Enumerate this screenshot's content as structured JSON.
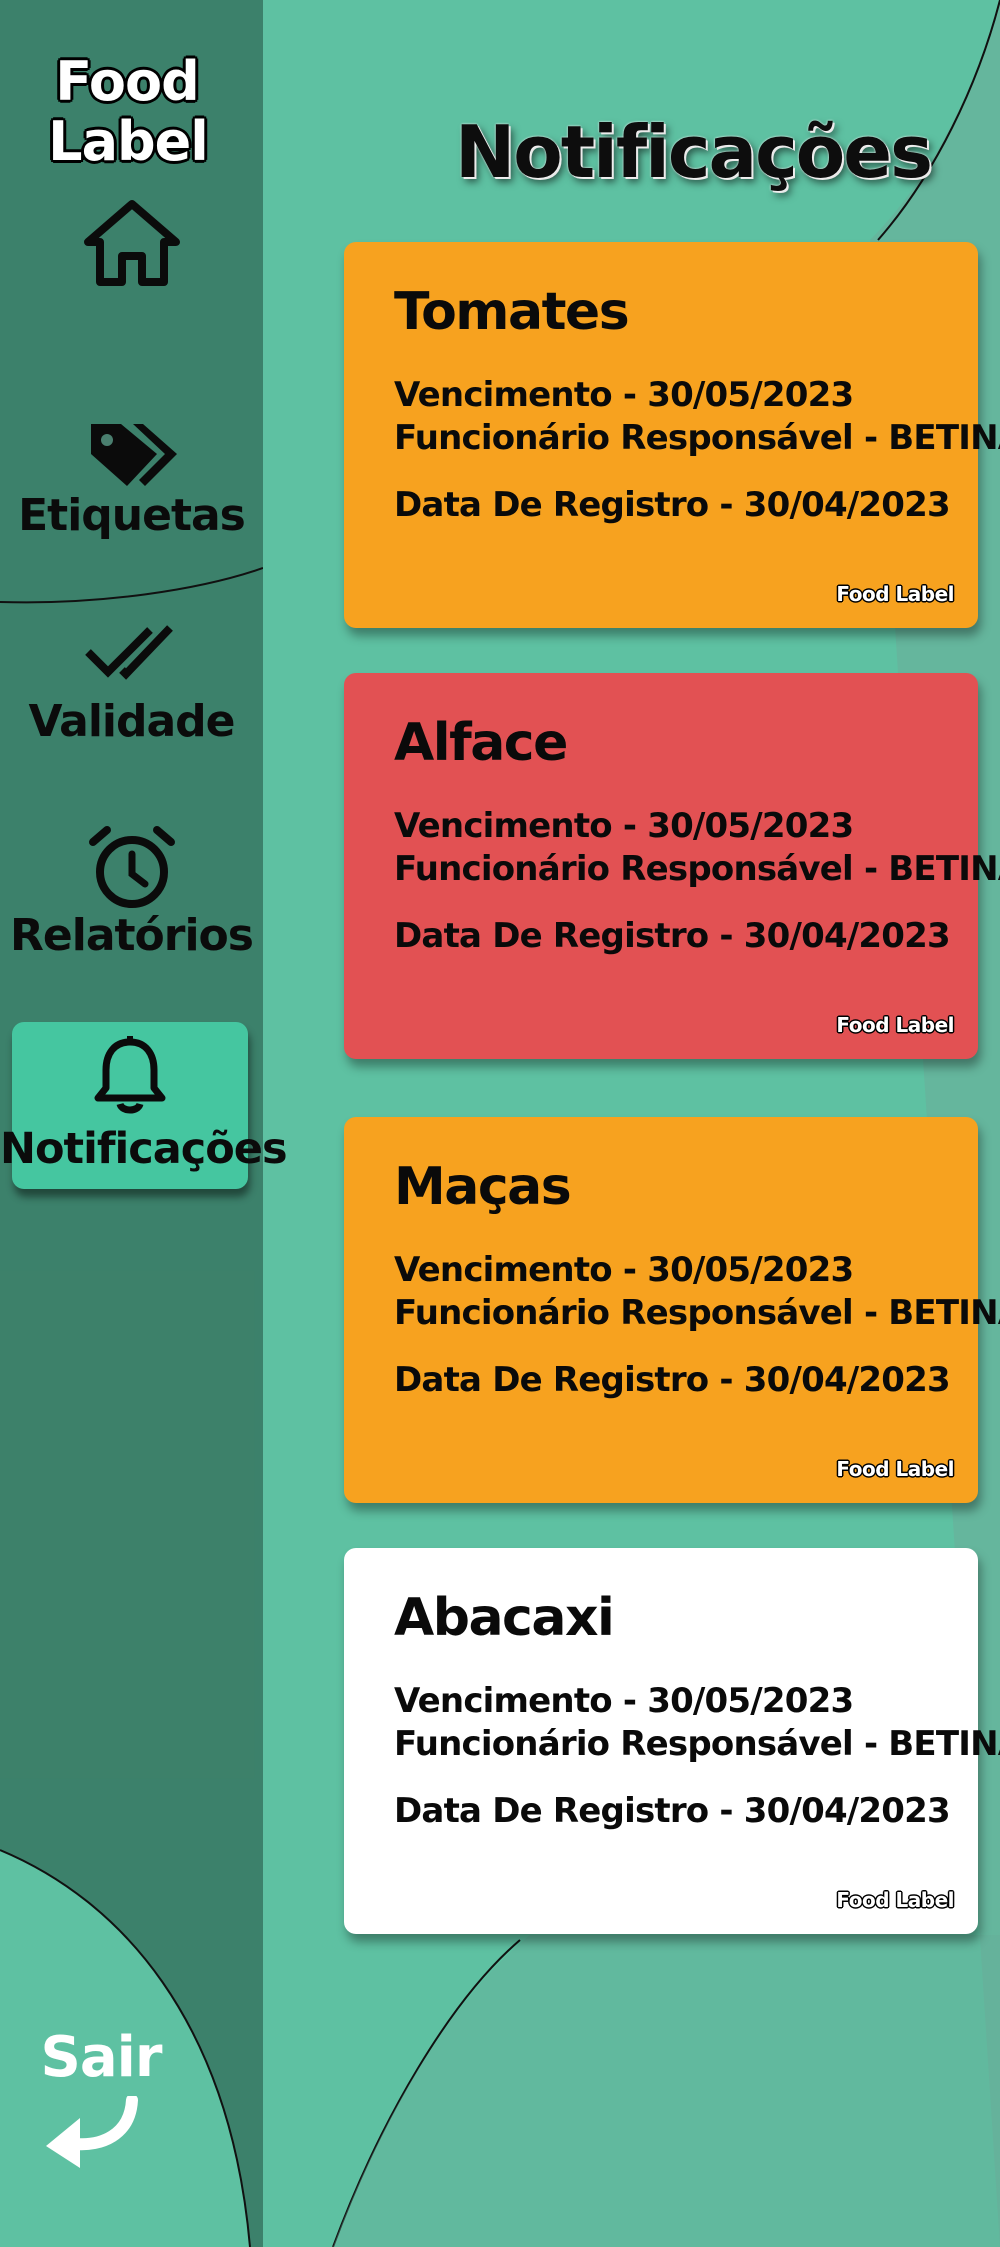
{
  "app": {
    "logo_line1": "Food",
    "logo_line2": "Label"
  },
  "sidebar": {
    "items": [
      {
        "label": "",
        "icon": "home-icon"
      },
      {
        "label": "Etiquetas",
        "icon": "tags-icon"
      },
      {
        "label": "Validade",
        "icon": "double-check-icon"
      },
      {
        "label": "Relatórios",
        "icon": "alarm-clock-icon"
      },
      {
        "label": "Notificações",
        "icon": "bell-icon",
        "active": true
      }
    ],
    "logout_label": "Sair",
    "logout_icon": "return-arrow-icon"
  },
  "main": {
    "title": "Notificações",
    "notifications": [
      {
        "product": "Tomates",
        "expiry": "Vencimento - 30/05/2023",
        "employee": "Funcionário Responsável - BETINA",
        "registered": "Data De Registro - 30/04/2023",
        "brand": "Food Label",
        "color": "#f7a21f"
      },
      {
        "product": "Alface",
        "expiry": "Vencimento - 30/05/2023",
        "employee": "Funcionário Responsável - BETINA",
        "registered": "Data De Registro - 30/04/2023",
        "brand": "Food Label",
        "color": "#e25153"
      },
      {
        "product": "Maças",
        "expiry": "Vencimento - 30/05/2023",
        "employee": "Funcionário Responsável - BETINA",
        "registered": "Data De Registro - 30/04/2023",
        "brand": "Food Label",
        "color": "#f7a21f"
      },
      {
        "product": "Abacaxi",
        "expiry": "Vencimento - 30/05/2023",
        "employee": "Funcionário Responsável - BETINA",
        "registered": "Data De Registro - 30/04/2023",
        "brand": "Food Label",
        "color": "#ffffff"
      }
    ]
  },
  "colors": {
    "background": "#5ec1a2",
    "sidebar": "#4a7f6f",
    "active_nav": "#45c6a0"
  }
}
